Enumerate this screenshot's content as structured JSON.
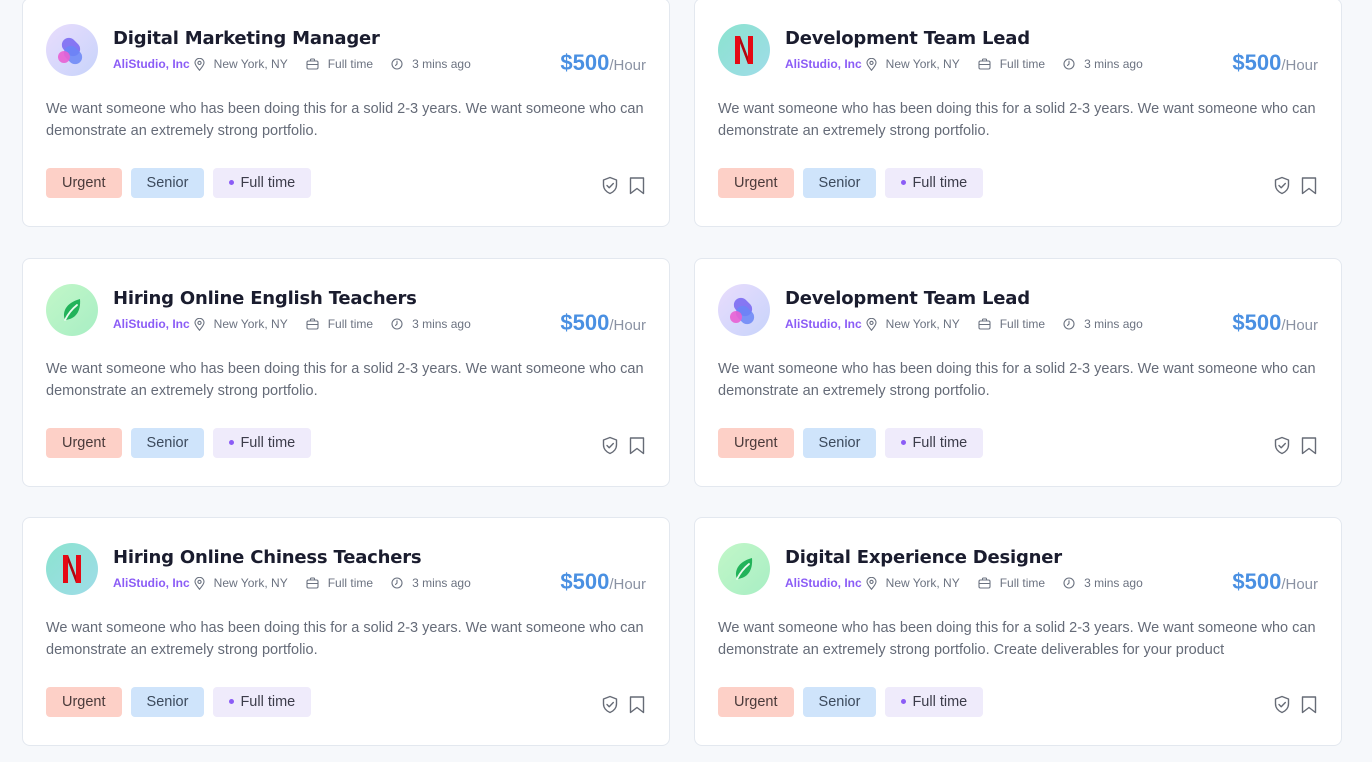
{
  "jobs": [
    {
      "title": "Digital Marketing Manager",
      "company": "AliStudio, Inc",
      "location": "New York, NY",
      "type": "Full time",
      "posted": "3 mins ago",
      "price": "$500",
      "unit": "/Hour",
      "logo": "stack-logo",
      "description": "We want someone who has been doing this for a solid 2-3 years. We want someone who can demonstrate an extremely strong portfolio.",
      "tags": {
        "urgent": "Urgent",
        "level": "Senior",
        "schedule": "Full time"
      }
    },
    {
      "title": "Development Team Lead",
      "company": "AliStudio, Inc",
      "location": "New York, NY",
      "type": "Full time",
      "posted": "3 mins ago",
      "price": "$500",
      "unit": "/Hour",
      "logo": "netflix-logo",
      "description": "We want someone who has been doing this for a solid 2-3 years. We want someone who can demonstrate an extremely strong portfolio.",
      "tags": {
        "urgent": "Urgent",
        "level": "Senior",
        "schedule": "Full time"
      }
    },
    {
      "title": "Hiring Online English Teachers",
      "company": "AliStudio, Inc",
      "location": "New York, NY",
      "type": "Full time",
      "posted": "3 mins ago",
      "price": "$500",
      "unit": "/Hour",
      "logo": "leaf-logo",
      "description": "We want someone who has been doing this for a solid 2-3 years. We want someone who can demonstrate an extremely strong portfolio.",
      "tags": {
        "urgent": "Urgent",
        "level": "Senior",
        "schedule": "Full time"
      }
    },
    {
      "title": "Development Team Lead",
      "company": "AliStudio, Inc",
      "location": "New York, NY",
      "type": "Full time",
      "posted": "3 mins ago",
      "price": "$500",
      "unit": "/Hour",
      "logo": "stack-logo",
      "description": "We want someone who has been doing this for a solid 2-3 years. We want someone who can demonstrate an extremely strong portfolio.",
      "tags": {
        "urgent": "Urgent",
        "level": "Senior",
        "schedule": "Full time"
      }
    },
    {
      "title": "Hiring Online Chiness Teachers",
      "company": "AliStudio, Inc",
      "location": "New York, NY",
      "type": "Full time",
      "posted": "3 mins ago",
      "price": "$500",
      "unit": "/Hour",
      "logo": "netflix-logo",
      "description": "We want someone who has been doing this for a solid 2-3 years. We want someone who can demonstrate an extremely strong portfolio.",
      "tags": {
        "urgent": "Urgent",
        "level": "Senior",
        "schedule": "Full time"
      }
    },
    {
      "title": "Digital Experience Designer",
      "company": "AliStudio, Inc",
      "location": "New York, NY",
      "type": "Full time",
      "posted": "3 mins ago",
      "price": "$500",
      "unit": "/Hour",
      "logo": "leaf-logo",
      "description": "We want someone who has been doing this for a solid 2-3 years. We want someone who can demonstrate an extremely strong portfolio. Create deliverables for your product",
      "tags": {
        "urgent": "Urgent",
        "level": "Senior",
        "schedule": "Full time"
      }
    }
  ],
  "colors": {
    "accent": "#4a90e2",
    "company": "#8b5cf6",
    "urgent_bg": "#fdd0c7",
    "senior_bg": "#cfe4fb",
    "fulltime_bg": "#efebfb"
  },
  "icons": {
    "location": "map-pin-icon",
    "type": "briefcase-icon",
    "posted": "clock-icon",
    "verify": "shield-check-icon",
    "save": "bookmark-icon"
  }
}
